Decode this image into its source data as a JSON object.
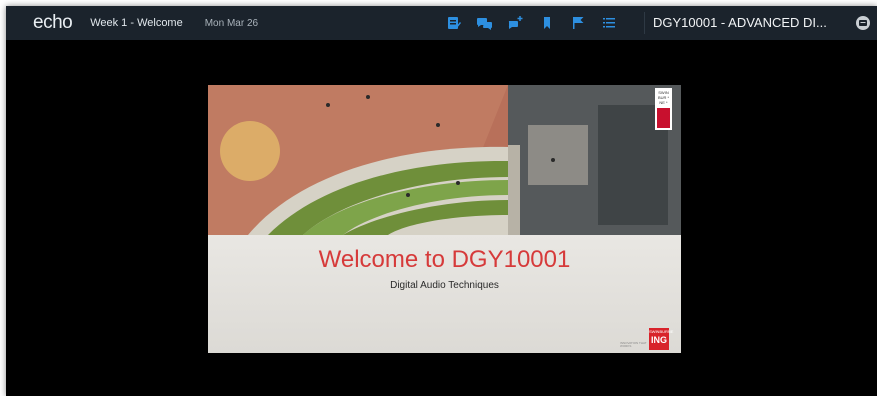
{
  "header": {
    "logo": "echo",
    "lesson_title": "Week 1 - Welcome",
    "date": "Mon Mar 26",
    "course_title": "DGY10001 - ADVANCED DI..."
  },
  "toolbar": {
    "icons": [
      "notes-icon",
      "discussion-icon",
      "ask-question-icon",
      "bookmark-icon",
      "flag-icon",
      "list-icon"
    ],
    "accent_color": "#2d8fe0"
  },
  "slide": {
    "title": "Welcome to DGY10001",
    "subtitle": "Digital Audio Techniques",
    "logo_text": "SWIN\nBUR\n* NE *",
    "badge_top": "SWINBURNE",
    "badge_main": "ING",
    "small_caption": "INNOVATION THAT WORKS"
  },
  "colors": {
    "topbar": "#1b232c",
    "stage": "#000000",
    "title_red": "#d63a3a"
  }
}
